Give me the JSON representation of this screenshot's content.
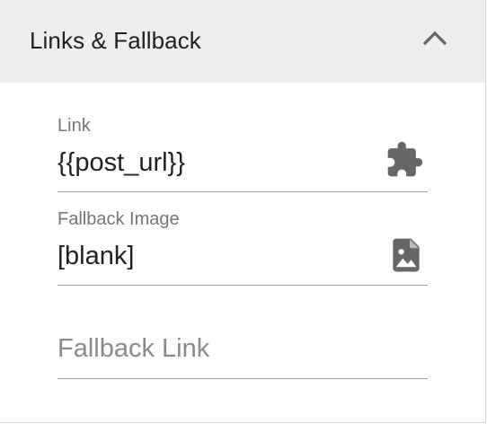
{
  "panel": {
    "title": "Links & Fallback",
    "toggle_icon": "chevron-up-icon"
  },
  "fields": {
    "link": {
      "label": "Link",
      "value": "{{post_url}}",
      "icon": "puzzle-piece-icon"
    },
    "fallback_image": {
      "label": "Fallback Image",
      "value": "[blank]",
      "icon": "image-file-icon"
    },
    "fallback_link": {
      "placeholder": "Fallback Link",
      "value": ""
    }
  },
  "colors": {
    "header_bg": "#eeeeee",
    "label": "#757575",
    "text": "#212121",
    "icon": "#666666",
    "underline": "#9e9e9e"
  }
}
